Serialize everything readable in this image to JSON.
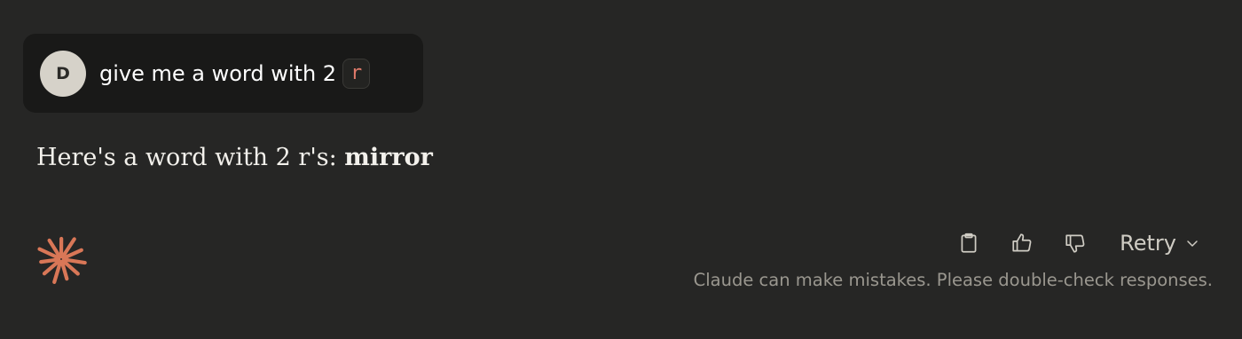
{
  "user_message": {
    "avatar_initial": "D",
    "text": "give me a word with 2",
    "inline_code": "r"
  },
  "assistant_message": {
    "text_prefix": "Here's a word with 2 r's: ",
    "bold_word": "mirror"
  },
  "logo": {
    "icon": "claude-sunburst-icon",
    "color": "#d97757"
  },
  "actions": {
    "copy_icon": "clipboard-icon",
    "thumbs_up_icon": "thumbs-up-icon",
    "thumbs_down_icon": "thumbs-down-icon",
    "retry_label": "Retry",
    "retry_dropdown_icon": "chevron-down-icon"
  },
  "disclaimer": "Claude can make mistakes. Please double-check responses.",
  "colors": {
    "background": "#262625",
    "user_bubble": "#191918",
    "inline_code_text": "#e07a6a",
    "text": "#f3f1ec",
    "muted": "#9a978f"
  }
}
